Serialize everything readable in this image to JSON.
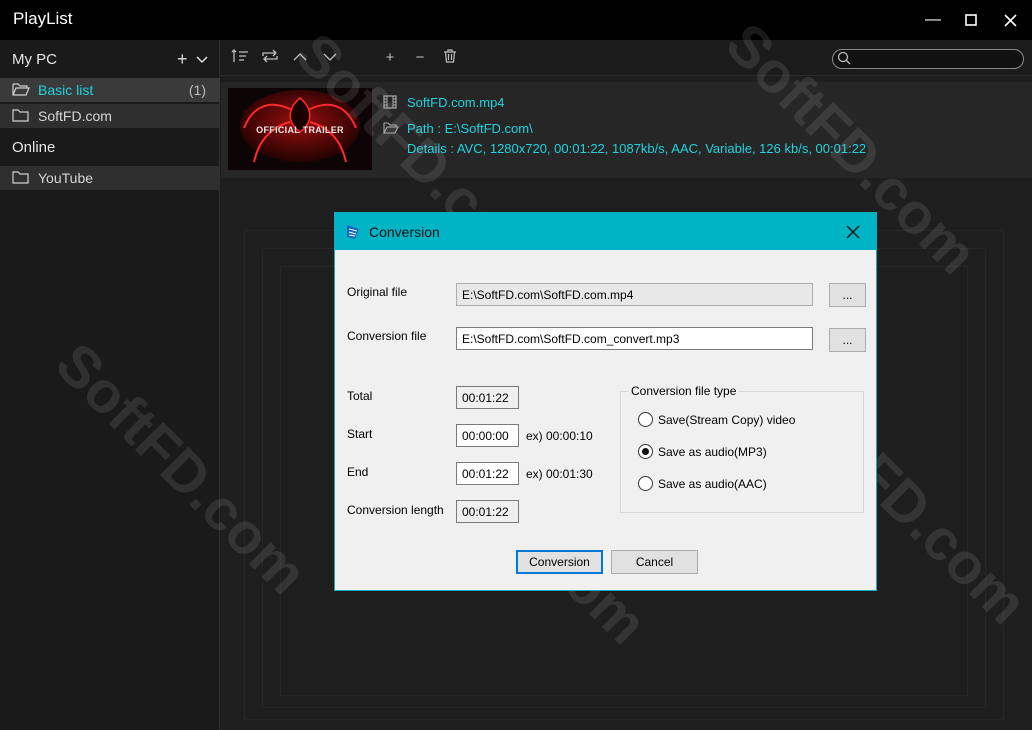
{
  "window": {
    "title": "PlayList"
  },
  "sidebar": {
    "my_pc_label": "My PC",
    "items": [
      {
        "label": "Basic list",
        "count": "(1)"
      },
      {
        "label": "SoftFD.com"
      }
    ],
    "online_label": "Online",
    "online_items": [
      {
        "label": "YouTube"
      }
    ]
  },
  "file": {
    "thumbnail_text": "OFFICIAL TRAILER",
    "name": "SoftFD.com.mp4",
    "path": "Path : E:\\SoftFD.com\\",
    "details": "Details : AVC, 1280x720, 00:01:22, 1087kb/s, AAC, Variable, 126 kb/s, 00:01:22"
  },
  "dialog": {
    "title": "Conversion",
    "original_file_label": "Original file",
    "original_file_value": "E:\\SoftFD.com\\SoftFD.com.mp4",
    "conversion_file_label": "Conversion file",
    "conversion_file_value": "E:\\SoftFD.com\\SoftFD.com_convert.mp3",
    "browse_label": "...",
    "total_label": "Total",
    "total_value": "00:01:22",
    "start_label": "Start",
    "start_value": "00:00:00",
    "start_example": "ex) 00:00:10",
    "end_label": "End",
    "end_value": "00:01:22",
    "end_example": "ex) 00:01:30",
    "length_label": "Conversion length",
    "length_value": "00:01:22",
    "type_group_label": "Conversion file type",
    "options": [
      {
        "label": "Save(Stream Copy) video",
        "selected": false
      },
      {
        "label": "Save as audio(MP3)",
        "selected": true
      },
      {
        "label": "Save as audio(AAC)",
        "selected": false
      }
    ],
    "convert_button": "Conversion",
    "cancel_button": "Cancel"
  },
  "watermark": "SoftFD.com",
  "colors": {
    "accent": "#1fd3e0",
    "dialog_header": "#00b4c6",
    "background": "#1e1e1e"
  }
}
